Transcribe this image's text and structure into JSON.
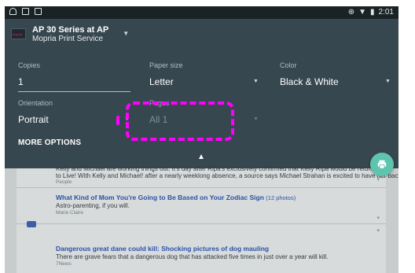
{
  "status_bar": {
    "time": "2:01"
  },
  "printer": {
    "name": "AP 30 Series at AP",
    "service": "Mopria Print Service",
    "logo_text": "mopria"
  },
  "fields": {
    "copies": {
      "label": "Copies",
      "value": "1"
    },
    "paper_size": {
      "label": "Paper size",
      "value": "Letter"
    },
    "color": {
      "label": "Color",
      "value": "Black & White"
    },
    "orientation": {
      "label": "Orientation",
      "value": "Portrait"
    },
    "pages": {
      "label": "Pages",
      "value": "All 1"
    }
  },
  "more_options": "MORE OPTIONS",
  "feed": {
    "item1": {
      "text": "Kelly and Michael are working things out. It's day after Ripa's exclusively confirmed that Kelly Ripa would be returning",
      "text2": "to Live! With Kelly and Michael! after a nearly weeklong absence, a source says Michael Strahan is excited to have her back.",
      "source": "People"
    },
    "item2": {
      "headline": "What Kind of Mom You're Going to Be Based on Your Zodiac Sign",
      "count": "(12 photos)",
      "text": "Astro-parenting, if you will.",
      "source": "Marie Claire"
    },
    "item3": {
      "headline": "Dangerous great dane could kill: Shocking pictures of dog mauling",
      "text": "There are grave fears that a dangerous dog that has attacked five times in just over a year will kill.",
      "source": "7News"
    }
  },
  "colors": {
    "sheet": "#37474f",
    "highlight": "#ff00ff",
    "fab": "#5fc4ae",
    "headline": "#2a51a6"
  }
}
